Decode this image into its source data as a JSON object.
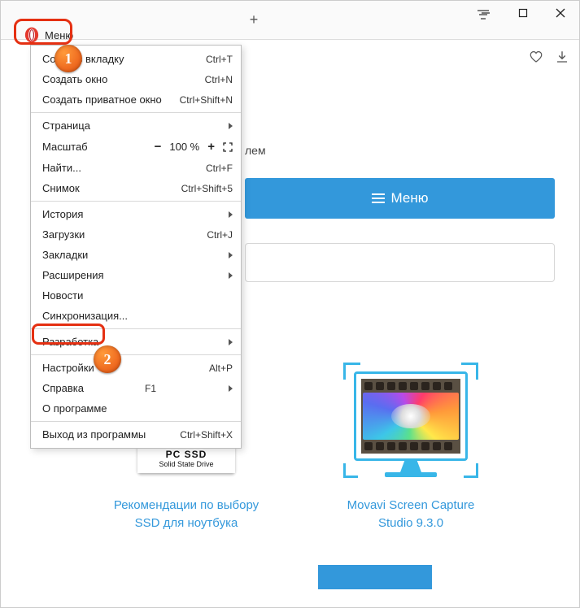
{
  "menu_button": {
    "label": "Меню"
  },
  "badges": {
    "b1": "1",
    "b2": "2"
  },
  "dropdown": {
    "groups": [
      [
        {
          "label": "Создать вкладку",
          "shortcut": "Ctrl+T"
        },
        {
          "label": "Создать окно",
          "shortcut": "Ctrl+N"
        },
        {
          "label": "Создать приватное окно",
          "shortcut": "Ctrl+Shift+N"
        }
      ],
      [
        {
          "label": "Страница",
          "sub": true
        },
        {
          "label": "Масштаб",
          "zoom": true,
          "minus": "−",
          "value": "100 %",
          "plus": "+"
        },
        {
          "label": "Найти...",
          "shortcut": "Ctrl+F"
        },
        {
          "label": "Снимок",
          "shortcut": "Ctrl+Shift+5"
        }
      ],
      [
        {
          "label": "История",
          "sub": true
        },
        {
          "label": "Загрузки",
          "shortcut": "Ctrl+J"
        },
        {
          "label": "Закладки",
          "sub": true
        },
        {
          "label": "Расширения",
          "sub": true
        },
        {
          "label": "Новости"
        },
        {
          "label": "Синхронизация..."
        }
      ],
      [
        {
          "label": "Разработка",
          "sub": true
        }
      ],
      [
        {
          "label": "Настройки",
          "shortcut": "Alt+P",
          "hl": true
        },
        {
          "label": "Справка",
          "shortcut": "F1",
          "sub": true
        },
        {
          "label": "О программе"
        }
      ],
      [
        {
          "label": "Выход из программы",
          "shortcut": "Ctrl+Shift+X"
        }
      ]
    ]
  },
  "page": {
    "subtext_suffix": "лем",
    "menu_bar_label": "Меню",
    "cards": [
      {
        "caption": "Рекомендации по выбору SSD для ноутбука",
        "ssd_line1": "PC SSD",
        "ssd_line2": "Solid State Drive"
      },
      {
        "caption": "Movavi Screen Capture Studio 9.3.0"
      }
    ]
  }
}
